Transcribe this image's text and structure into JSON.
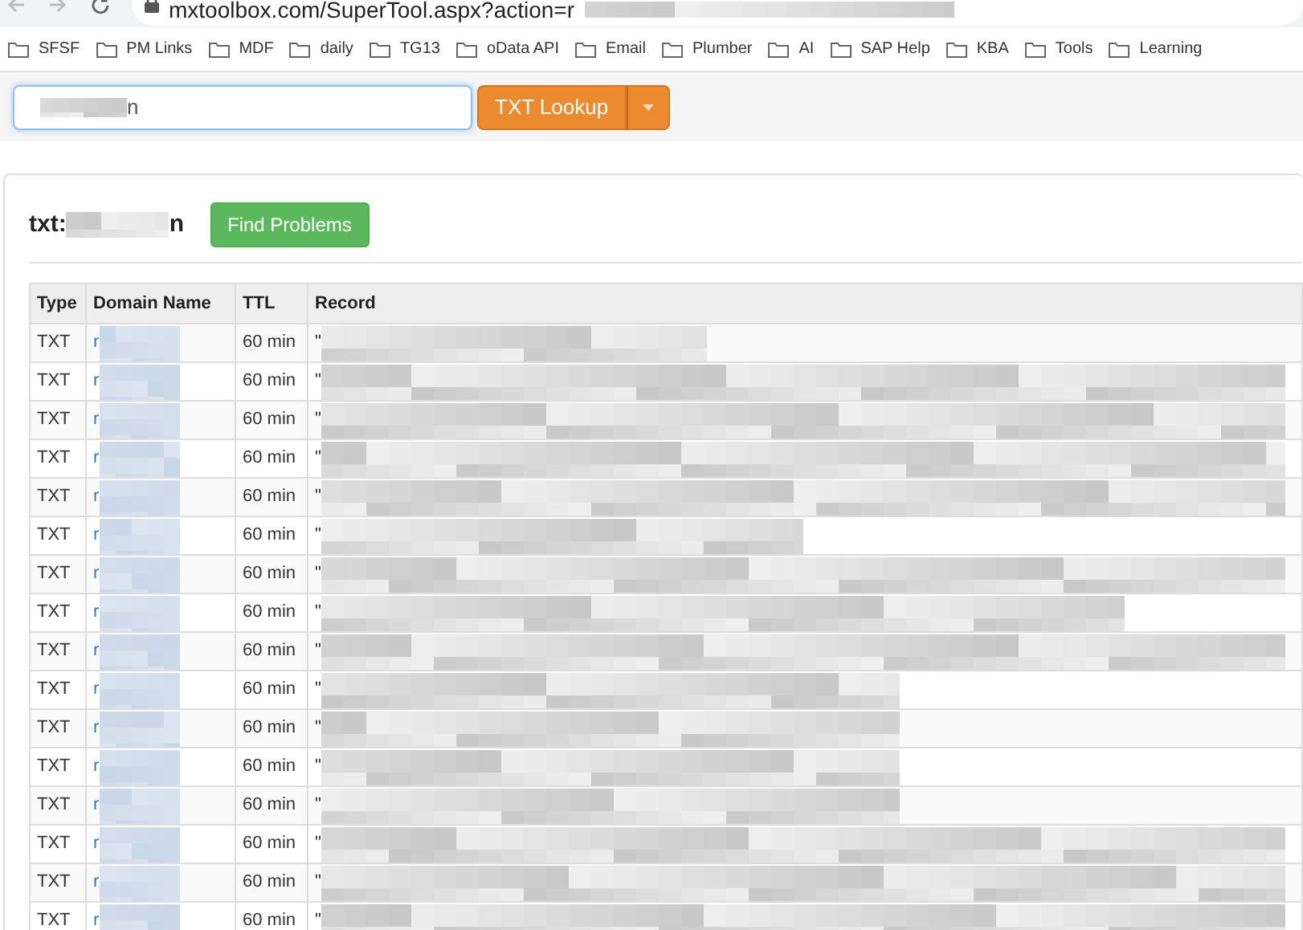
{
  "browser": {
    "url": "mxtoolbox.com/SuperTool.aspx?action=r"
  },
  "bookmarks": [
    "SFSF",
    "PM Links",
    "MDF",
    "daily",
    "TG13",
    "oData API",
    "Email",
    "Plumber",
    "AI",
    "SAP Help",
    "KBA",
    "Tools",
    "Learning"
  ],
  "search": {
    "value": "n",
    "button": "TXT Lookup"
  },
  "result": {
    "title_prefix": "txt:",
    "title_suffix": "n",
    "action": "Find Problems",
    "table": {
      "columns": [
        "Type",
        "Domain Name",
        "TTL",
        "Record"
      ],
      "rows": [
        {
          "type": "TXT",
          "domain": "r",
          "ttl": "60 min",
          "record": "\""
        },
        {
          "type": "TXT",
          "domain": "r",
          "ttl": "60 min",
          "record": "\""
        },
        {
          "type": "TXT",
          "domain": "r",
          "ttl": "60 min",
          "record": "\""
        },
        {
          "type": "TXT",
          "domain": "r",
          "ttl": "60 min",
          "record": "\""
        },
        {
          "type": "TXT",
          "domain": "r",
          "ttl": "60 min",
          "record": "\""
        },
        {
          "type": "TXT",
          "domain": "r",
          "ttl": "60 min",
          "record": "\""
        },
        {
          "type": "TXT",
          "domain": "r",
          "ttl": "60 min",
          "record": "\""
        },
        {
          "type": "TXT",
          "domain": "r",
          "ttl": "60 min",
          "record": "\""
        },
        {
          "type": "TXT",
          "domain": "r",
          "ttl": "60 min",
          "record": "\""
        },
        {
          "type": "TXT",
          "domain": "r",
          "ttl": "60 min",
          "record": "\""
        },
        {
          "type": "TXT",
          "domain": "r",
          "ttl": "60 min",
          "record": "\""
        },
        {
          "type": "TXT",
          "domain": "r",
          "ttl": "60 min",
          "record": "\""
        },
        {
          "type": "TXT",
          "domain": "r",
          "ttl": "60 min",
          "record": "\""
        },
        {
          "type": "TXT",
          "domain": "r",
          "ttl": "60 min",
          "record": "\""
        },
        {
          "type": "TXT",
          "domain": "r",
          "ttl": "60 min",
          "record": "\""
        },
        {
          "type": "TXT",
          "domain": "r",
          "ttl": "60 min",
          "record": "\""
        }
      ]
    }
  }
}
